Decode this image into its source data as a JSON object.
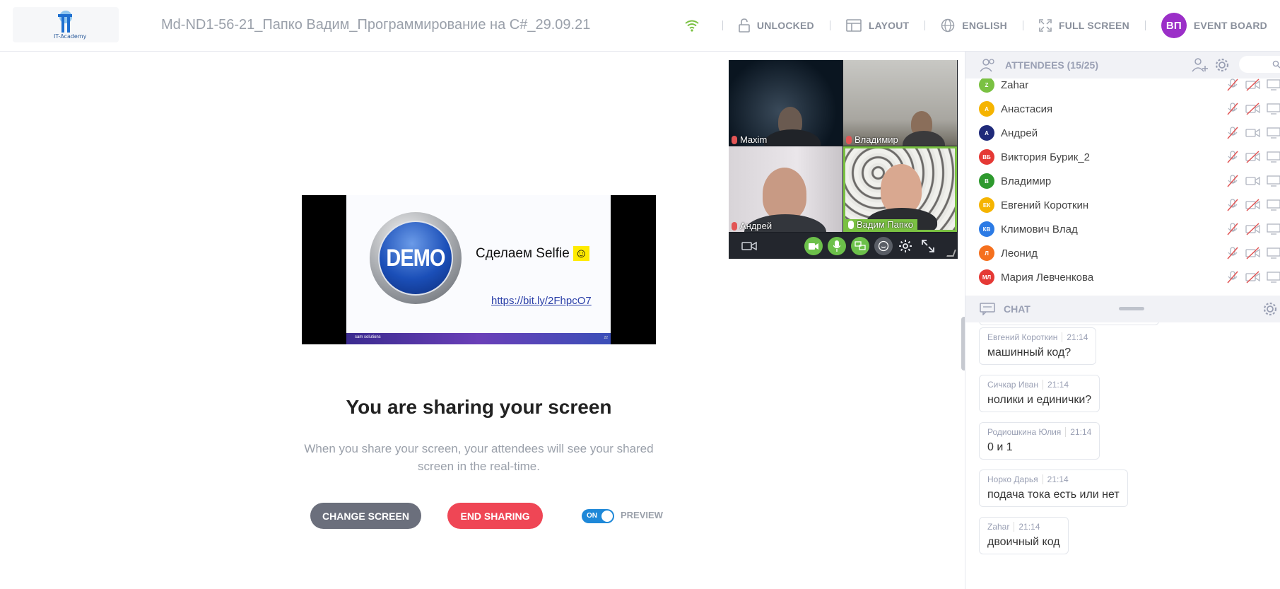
{
  "header": {
    "logo_text": "IT-Academy",
    "meeting_title": "Md-ND1-56-21_Папко Вадим_Программирование на C#_29.09.21",
    "tools": {
      "lock_label": "UNLOCKED",
      "layout_label": "LAYOUT",
      "language_label": "ENGLISH",
      "fullscreen_label": "FULL SCREEN",
      "avatar_initials": "ВП",
      "event_board_label": "EVENT BOARD"
    }
  },
  "share": {
    "slide": {
      "demo_text": "DEMO",
      "caption": "Сделаем Selfie",
      "emoji": "☺",
      "link": "https://bit.ly/2FhpcO7",
      "footer_left": "sam solutions",
      "footer_right": "22"
    },
    "title": "You are sharing your screen",
    "description": "When you share your screen, your attendees will see your shared screen in the real-time.",
    "change_screen_label": "CHANGE SCREEN",
    "end_sharing_label": "END SHARING",
    "toggle_label": "ON",
    "preview_label": "PREVIEW"
  },
  "videos": [
    {
      "name": "Maxim"
    },
    {
      "name": "Владимир"
    },
    {
      "name": "Андрей"
    },
    {
      "name": "Вадим Папко"
    }
  ],
  "attendees": {
    "header_label": "ATTENDEES (15/25)",
    "items": [
      {
        "initials": "Z",
        "name": "Zahar",
        "color": "#7ac142"
      },
      {
        "initials": "A",
        "name": "Анастасия",
        "color": "#f5b400"
      },
      {
        "initials": "A",
        "name": "Андрей",
        "color": "#1f2a7a"
      },
      {
        "initials": "ВБ",
        "name": "Виктория Бурик_2",
        "color": "#e53935"
      },
      {
        "initials": "В",
        "name": "Владимир",
        "color": "#2e9a2e"
      },
      {
        "initials": "ЕК",
        "name": "Евгений Короткин",
        "color": "#f5b400"
      },
      {
        "initials": "КВ",
        "name": "Климович Влад",
        "color": "#2c7be5"
      },
      {
        "initials": "Л",
        "name": "Леонид",
        "color": "#f5701e"
      },
      {
        "initials": "МЛ",
        "name": "Мария Левченкова",
        "color": "#e53935"
      }
    ]
  },
  "chat": {
    "header_label": "CHAT",
    "messages": [
      {
        "author": "Евгений Короткин",
        "time": "21:14",
        "text": "машинный код?"
      },
      {
        "author": "Сичкар Иван",
        "time": "21:14",
        "text": "нолики и единички?"
      },
      {
        "author": "Родиошкина Юлия",
        "time": "21:14",
        "text": "0 и 1"
      },
      {
        "author": "Норко Дарья",
        "time": "21:14",
        "text": "подача тока есть или нет"
      },
      {
        "author": "Zahar",
        "time": "21:14",
        "text": "двоичный код"
      }
    ]
  }
}
